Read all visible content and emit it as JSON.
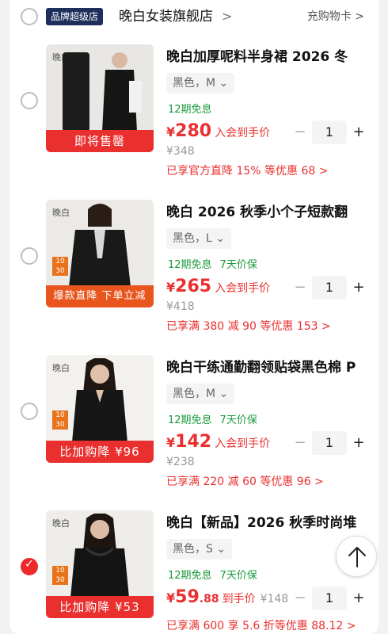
{
  "shop": {
    "badge": "品牌超级店",
    "name": "晚白女装旗舰店",
    "arrow": ">",
    "coupon_label": "充购物卡 >"
  },
  "items": [
    {
      "title": "晚白加厚呢料半身裙 2026 冬",
      "sku": "黑色，M",
      "promos": [
        "12期免息"
      ],
      "price_currency": "¥",
      "price_int": "280",
      "price_dec": "",
      "price_note": "入会到手价",
      "old_price": "¥348",
      "discount": "已享官方直降 15% 等优惠 68 >",
      "qty": "1",
      "thumb_banner": "即将售罄",
      "checked": false
    },
    {
      "title": "晚白 2026 秋季小个子短款翻",
      "sku": "黑色，L",
      "promos": [
        "12期免息",
        "7天价保"
      ],
      "price_currency": "¥",
      "price_int": "265",
      "price_dec": "",
      "price_note": "入会到手价",
      "old_price": "¥418",
      "discount": "已享满 380 减 90 等优惠 153 >",
      "qty": "1",
      "thumb_banner": "爆款直降 下单立减",
      "checked": false
    },
    {
      "title": "晚白干练通勤翻领贴袋黑色棉 P",
      "sku": "黑色，M",
      "promos": [
        "12期免息",
        "7天价保"
      ],
      "price_currency": "¥",
      "price_int": "142",
      "price_dec": "",
      "price_note": "入会到手价",
      "old_price": "¥238",
      "discount": "已享满 220 减 60 等优惠 96 >",
      "qty": "1",
      "thumb_banner": "比加购降 ¥96",
      "checked": false
    },
    {
      "title": "晚白【新品】2026 秋季时尚堆",
      "sku": "黑色，S",
      "promos": [
        "12期免息",
        "7天价保"
      ],
      "price_currency": "¥",
      "price_int": "59",
      "price_dec": ".88",
      "price_note": "到手价",
      "old_price": "¥148",
      "discount": "已享满 600 享 5.6 折等优惠 88.12 >",
      "qty": "1",
      "thumb_banner": "比加购降 ¥53",
      "checked": true
    }
  ],
  "stepper": {
    "minus": "−",
    "plus": "+"
  },
  "colors": {
    "accent": "#ea2f2f",
    "green": "#1a9b3c",
    "badge": "#1f2f5c"
  },
  "icons": {
    "radio": "radio-circle-icon",
    "to_top": "arrow-up-icon"
  }
}
